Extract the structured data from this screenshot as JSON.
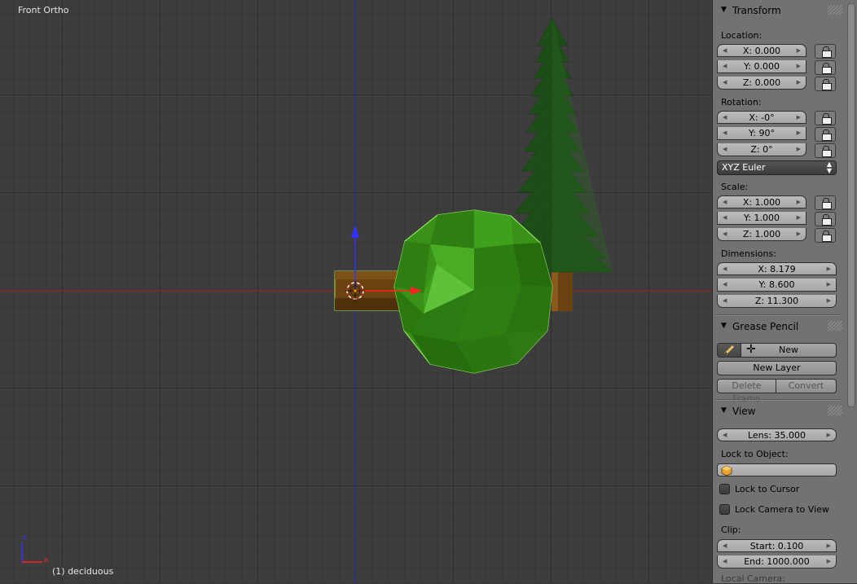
{
  "viewport": {
    "view_name": "Front Ortho",
    "active_object": "(1) deciduous",
    "axis_widget": {
      "z_label": "z",
      "x_label": "x"
    },
    "colors": {
      "background": "#3d3d3d",
      "foliage": "#3f9a1a",
      "trunk": "#6b4310",
      "pine": "#1d4e18",
      "x_axis": "#dd2222",
      "y_axis": "#2222dd",
      "selection": "#8fe060"
    }
  },
  "panel": {
    "transform": {
      "header": "Transform",
      "location_label": "Location:",
      "location": [
        "X: 0.000",
        "Y: 0.000",
        "Z: 0.000"
      ],
      "rotation_label": "Rotation:",
      "rotation": [
        "X: -0°",
        "Y: 90°",
        "Z: 0°"
      ],
      "rotation_mode": "XYZ Euler",
      "scale_label": "Scale:",
      "scale": [
        "X: 1.000",
        "Y: 1.000",
        "Z: 1.000"
      ],
      "dimensions_label": "Dimensions:",
      "dimensions": [
        "X: 8.179",
        "Y: 8.600",
        "Z: 11.300"
      ]
    },
    "grease_pencil": {
      "header": "Grease Pencil",
      "new_label": "New",
      "new_layer_label": "New Layer",
      "delete_frame_label": "Delete Frame",
      "convert_label": "Convert",
      "icons": [
        "pencil-icon",
        "plus-icon"
      ]
    },
    "view": {
      "header": "View",
      "lens": "Lens: 35.000",
      "lock_to_object_label": "Lock to Object:",
      "lock_to_cursor_label": "Lock to Cursor",
      "lock_camera_label": "Lock Camera to View",
      "clip_label": "Clip:",
      "clip_start": "Start: 0.100",
      "clip_end": "End: 1000.000",
      "local_camera_label": "Local Camera:"
    }
  }
}
